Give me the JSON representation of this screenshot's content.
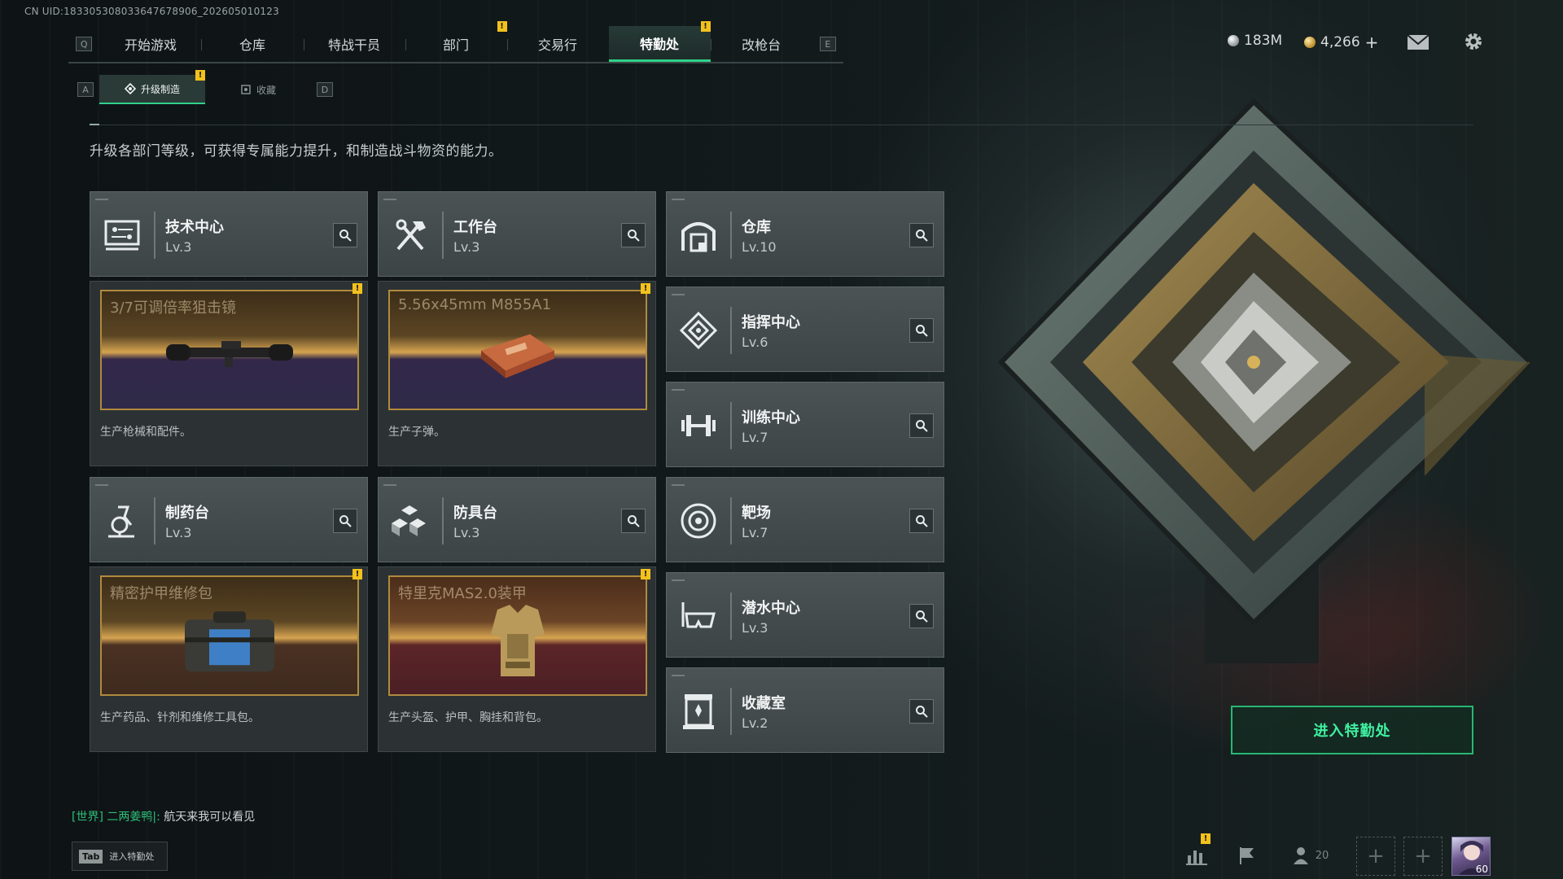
{
  "uid": "CN UID:1833053080336476​78906_202605010123",
  "nav": {
    "left_key": "Q",
    "right_key": "E",
    "tabs": [
      {
        "label": "开始游戏",
        "badge": ""
      },
      {
        "label": "仓库",
        "badge": ""
      },
      {
        "label": "特战干员",
        "badge": ""
      },
      {
        "label": "部门",
        "badge": "!"
      },
      {
        "label": "交易行",
        "badge": ""
      },
      {
        "label": "特勤处",
        "badge": "!",
        "active": true
      },
      {
        "label": "改枪台",
        "badge": ""
      }
    ]
  },
  "currency": {
    "silver": "183M",
    "gold": "4,266",
    "plus": "+"
  },
  "subnav": {
    "left_key": "A",
    "right_key": "D",
    "tabs": [
      {
        "label": "升级制造",
        "badge": "!"
      },
      {
        "label": "收藏",
        "badge": ""
      }
    ]
  },
  "description": "升级各部门等级，可获得专属能力提升，和制造战斗物资的能力。",
  "departments": [
    {
      "name": "技术中心",
      "level": "Lv.3",
      "icon": "tech-center-icon"
    },
    {
      "name": "工作台",
      "level": "Lv.3",
      "icon": "workbench-icon"
    },
    {
      "name": "仓库",
      "level": "Lv.10",
      "icon": "warehouse-icon"
    },
    {
      "name": "指挥中心",
      "level": "Lv.6",
      "icon": "command-center-icon"
    },
    {
      "name": "训练中心",
      "level": "Lv.7",
      "icon": "training-center-icon"
    },
    {
      "name": "制药台",
      "level": "Lv.3",
      "icon": "pharmacy-icon"
    },
    {
      "name": "防具台",
      "level": "Lv.3",
      "icon": "armor-bench-icon"
    },
    {
      "name": "靶场",
      "level": "Lv.7",
      "icon": "shooting-range-icon"
    },
    {
      "name": "潜水中心",
      "level": "Lv.3",
      "icon": "diving-center-icon"
    },
    {
      "name": "收藏室",
      "level": "Lv.2",
      "icon": "collection-room-icon"
    }
  ],
  "productions": [
    {
      "title": "3/7可调倍率狙击镜",
      "note": "生产枪械和配件。",
      "badge": "!",
      "theme": "blue"
    },
    {
      "title": "5.56x45mm M855A1",
      "note": "生产子弹。",
      "badge": "!",
      "theme": "blue"
    },
    {
      "title": "精密护甲维修包",
      "note": "生产药品、针剂和维修工具包。",
      "badge": "!",
      "theme": "red"
    },
    {
      "title": "特里克MAS2.0装甲",
      "note": "生产头盔、护甲、胸挂和背包。",
      "badge": "!",
      "theme": "red"
    }
  ],
  "enter_button": "进入特勤处",
  "chat": {
    "channel": "[世界]",
    "sender": "二两姜鸭|:",
    "message": "航天来我可以看见"
  },
  "tab_hint": {
    "key": "Tab",
    "label": "进入特勤处"
  },
  "bottom_bar": {
    "stats_badge": "!",
    "friends_count": "20",
    "add_slot": "+",
    "avatar_level": "60"
  },
  "colors": {
    "accent_green": "#2fd28a",
    "badge_yellow": "#f2c11c",
    "card_bg": "#464e50"
  }
}
